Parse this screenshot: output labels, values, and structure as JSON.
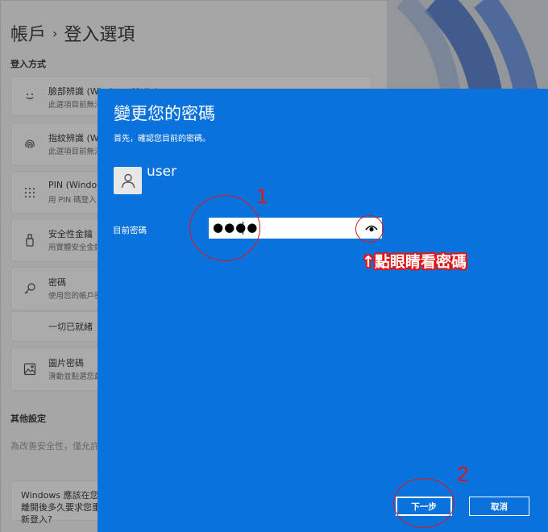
{
  "settings": {
    "breadcrumb": {
      "parent": "帳戶",
      "separator": "›",
      "current": "登入選項"
    },
    "sign_in_section_title": "登入方式",
    "options": [
      {
        "icon": "face-icon",
        "title": "臉部辨識 (Windows Hello)",
        "desc": "此選項目前無法使用"
      },
      {
        "icon": "fingerprint-icon",
        "title": "指紋辨識 (Windows Hello)",
        "desc": "此選項目前無法使用"
      },
      {
        "icon": "pin-icon",
        "title": "PIN (Windows Hello)",
        "desc": "用 PIN 碼登入"
      },
      {
        "icon": "security-key-icon",
        "title": "安全性金鑰",
        "desc": "用實體安全金鑰登入"
      },
      {
        "icon": "key-icon",
        "title": "密碼",
        "desc": "使用您的帳戶密碼登入"
      },
      {
        "icon": "",
        "title": "一切已就緒",
        "desc": ""
      },
      {
        "icon": "picture-icon",
        "title": "圖片密碼",
        "desc": "滑動並點選您最愛的相片以登入"
      }
    ],
    "other_section_title": "其他設定",
    "other_text_1": "為改善安全性，僅允許 Windows Hello 登入",
    "other_card_text": "Windows 應該在您離開後多久要求您重新登入?"
  },
  "dialog": {
    "title": "變更您的密碼",
    "subtitle": "首先，確認您目前的密碼。",
    "username": "user",
    "password_label": "目前密碼",
    "password_value": "●●●●",
    "reveal_icon": "eye-icon",
    "next_label": "下一步",
    "cancel_label": "取消",
    "accent_color": "#0a72dc"
  },
  "annotations": {
    "step1": "1",
    "step2": "2",
    "hint": "↑點眼睛看密碼",
    "color": "#e31414"
  }
}
